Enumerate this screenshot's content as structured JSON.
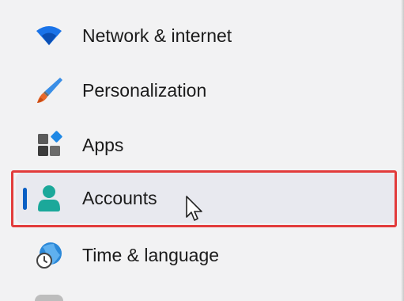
{
  "nav": {
    "items": [
      {
        "label": "Network & internet",
        "icon": "wifi-icon"
      },
      {
        "label": "Personalization",
        "icon": "paintbrush-icon"
      },
      {
        "label": "Apps",
        "icon": "apps-icon"
      },
      {
        "label": "Accounts",
        "icon": "account-icon",
        "selected": true
      },
      {
        "label": "Time & language",
        "icon": "time-language-icon"
      }
    ]
  },
  "colors": {
    "background": "#f2f2f3",
    "selected_background": "#e8e9ef",
    "selection_indicator": "#0a5fc4",
    "highlight_border": "#e23b3b",
    "wifi": "#1a73e8",
    "account": "#1ba89a"
  }
}
